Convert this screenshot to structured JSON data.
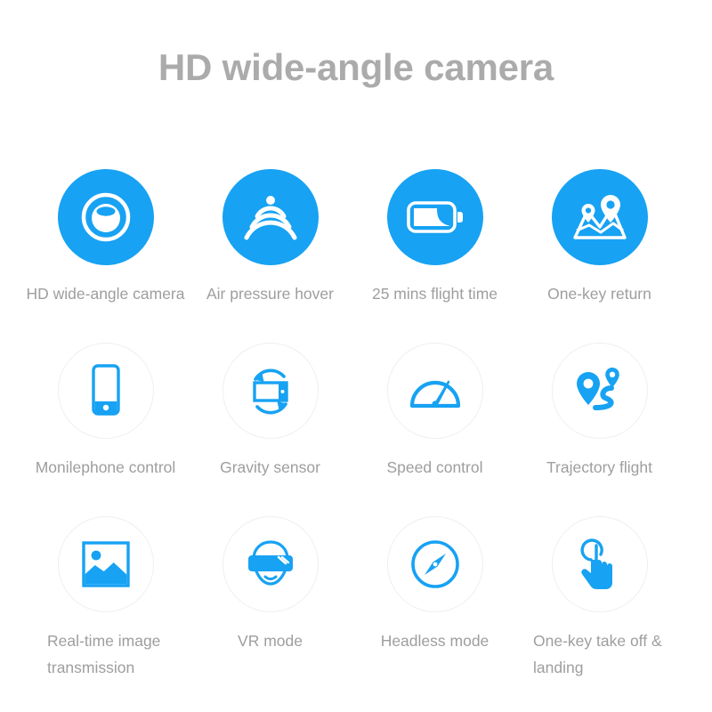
{
  "header": {
    "title": "HD wide-angle camera"
  },
  "theme": {
    "accent_blue": "#17a2f3",
    "label_gray": "#9e9e9e",
    "title_gray": "#ababab",
    "circle_border": "#efefef",
    "background": "#ffffff"
  },
  "features": {
    "row1": [
      {
        "icon": "camera-lens-icon",
        "label": "HD wide-angle camera",
        "style": "filled"
      },
      {
        "icon": "air-pressure-wave-icon",
        "label": "Air pressure hover",
        "style": "filled"
      },
      {
        "icon": "battery-icon",
        "label": "25 mins flight time",
        "style": "filled"
      },
      {
        "icon": "map-pins-return-icon",
        "label": "One-key return",
        "style": "filled"
      }
    ],
    "row2": [
      {
        "icon": "mobile-phone-icon",
        "label": "Monilephone control",
        "style": "outline"
      },
      {
        "icon": "gravity-rotate-icon",
        "label": "Gravity sensor",
        "style": "outline"
      },
      {
        "icon": "speedometer-icon",
        "label": "Speed control",
        "style": "outline"
      },
      {
        "icon": "trajectory-route-icon",
        "label": "Trajectory flight",
        "style": "outline"
      }
    ],
    "row3": [
      {
        "icon": "photo-image-icon",
        "label": "Real-time image transmission",
        "style": "outline"
      },
      {
        "icon": "vr-headset-icon",
        "label": "VR mode",
        "style": "outline"
      },
      {
        "icon": "compass-icon",
        "label": "Headless mode",
        "style": "outline"
      },
      {
        "icon": "tap-hand-icon",
        "label": "One-key take off & landing",
        "style": "outline"
      }
    ]
  }
}
